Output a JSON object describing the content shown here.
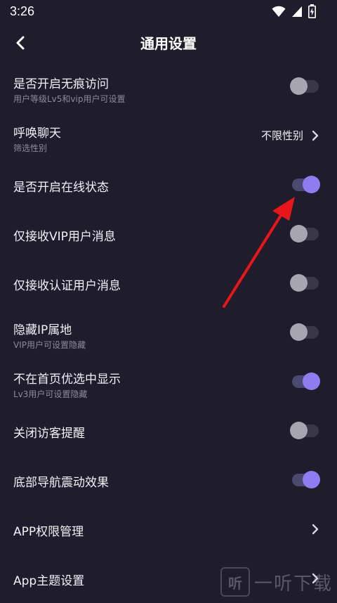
{
  "status_bar": {
    "time": "3:26",
    "icons": [
      "wifi-icon",
      "cell-signal-icon",
      "battery-charging-icon"
    ]
  },
  "header": {
    "title": "通用设置",
    "back_icon": "chevron-left-icon"
  },
  "settings": [
    {
      "title": "是否开启无痕访问",
      "subtitle": "用户等级Lv5和vip用户可设置",
      "control": "toggle",
      "on": false
    },
    {
      "title": "呼唤聊天",
      "subtitle": "筛选性别",
      "control": "value",
      "value": "不限性别"
    },
    {
      "title": "是否开启在线状态",
      "control": "toggle",
      "on": true
    },
    {
      "title": "仅接收VIP用户消息",
      "control": "toggle",
      "on": false
    },
    {
      "title": "仅接收认证用户消息",
      "control": "toggle",
      "on": false
    },
    {
      "title": "隐藏IP属地",
      "subtitle": "VIP用户可设置隐藏",
      "control": "toggle",
      "on": false
    },
    {
      "title": "不在首页优选中显示",
      "subtitle": "Lv3用户可设置隐藏",
      "control": "toggle",
      "on": true
    },
    {
      "title": "关闭访客提醒",
      "control": "toggle",
      "on": false
    },
    {
      "title": "底部导航震动效果",
      "control": "toggle",
      "on": true
    },
    {
      "title": "APP权限管理",
      "control": "link"
    },
    {
      "title": "App主题设置",
      "control": "link"
    }
  ],
  "annotation": {
    "type": "red-arrow",
    "color": "#e8151b",
    "points_to": "是否开启在线状态"
  },
  "watermark": {
    "badge": "听",
    "text": "一听下载"
  },
  "colors": {
    "background": "#1f1c2c",
    "toggle_on": "#8f7cf0",
    "toggle_off": "#a7a5b0"
  }
}
